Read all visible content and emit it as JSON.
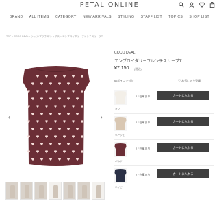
{
  "site": {
    "logo": "PETAL ONLINE"
  },
  "header_icons": [
    "search-icon",
    "user-icon",
    "heart-icon",
    "bag-icon"
  ],
  "nav": [
    {
      "label": "BRAND"
    },
    {
      "label": "ALL ITEMS"
    },
    {
      "label": "CATEGORY"
    },
    {
      "label": "NEW ARRIVALS"
    },
    {
      "label": "STYLING"
    },
    {
      "label": "STAFF LIST"
    },
    {
      "label": "TOPICS"
    },
    {
      "label": "SHOP LIST"
    }
  ],
  "breadcrumb": "TOP > COCO DEAL > シャツ/ブラウス/トップス > エンブロイダリーフレンチスリーブT",
  "product": {
    "brand": "COCO DEAL",
    "name": "エンブロイダリーフレンチスリーブT",
    "price": "¥7,150",
    "tax": "(税込)",
    "points": "65ポイント付与",
    "favorite": "♡ お気に入り登録"
  },
  "carousel": {
    "prev": "‹",
    "next": "›",
    "color": "#6b2e36",
    "heart_color": "#f4dcd8"
  },
  "variants": [
    {
      "color_label": "オフ",
      "swatch": "#f3efe8",
      "size_text": "2 / 在庫あり",
      "button": "カートに入れる"
    },
    {
      "color_label": "ベージュ",
      "swatch": "#d9c7b2",
      "size_text": "2 / 在庫あり",
      "button": "カートに入れる"
    },
    {
      "color_label": "ボルドー",
      "swatch": "#6b2e36",
      "size_text": "2 / 在庫あり",
      "button": "カートに入れる"
    },
    {
      "color_label": "ネイビー",
      "swatch": "#2b3146",
      "size_text": "2 / 在庫あり",
      "button": "カートに入れる"
    }
  ]
}
